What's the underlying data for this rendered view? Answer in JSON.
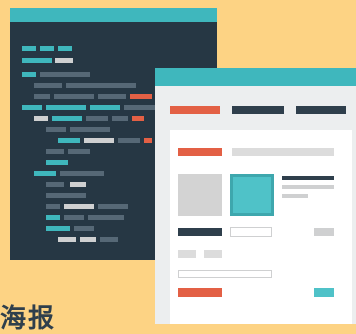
{
  "colors": {
    "background": "#fdd384",
    "editor_bg": "#263744",
    "teal": "#3fb7bd",
    "teal_light": "#4fc2c8",
    "orange": "#e36045",
    "navy": "#2f3f4c",
    "gray": "#cfd0d1",
    "white_panel": "#f5f5f5",
    "white_inner": "#ffffff"
  },
  "icons": {
    "code_editor": "code-editor-window-icon",
    "browser": "browser-window-icon"
  },
  "caption": "海报"
}
